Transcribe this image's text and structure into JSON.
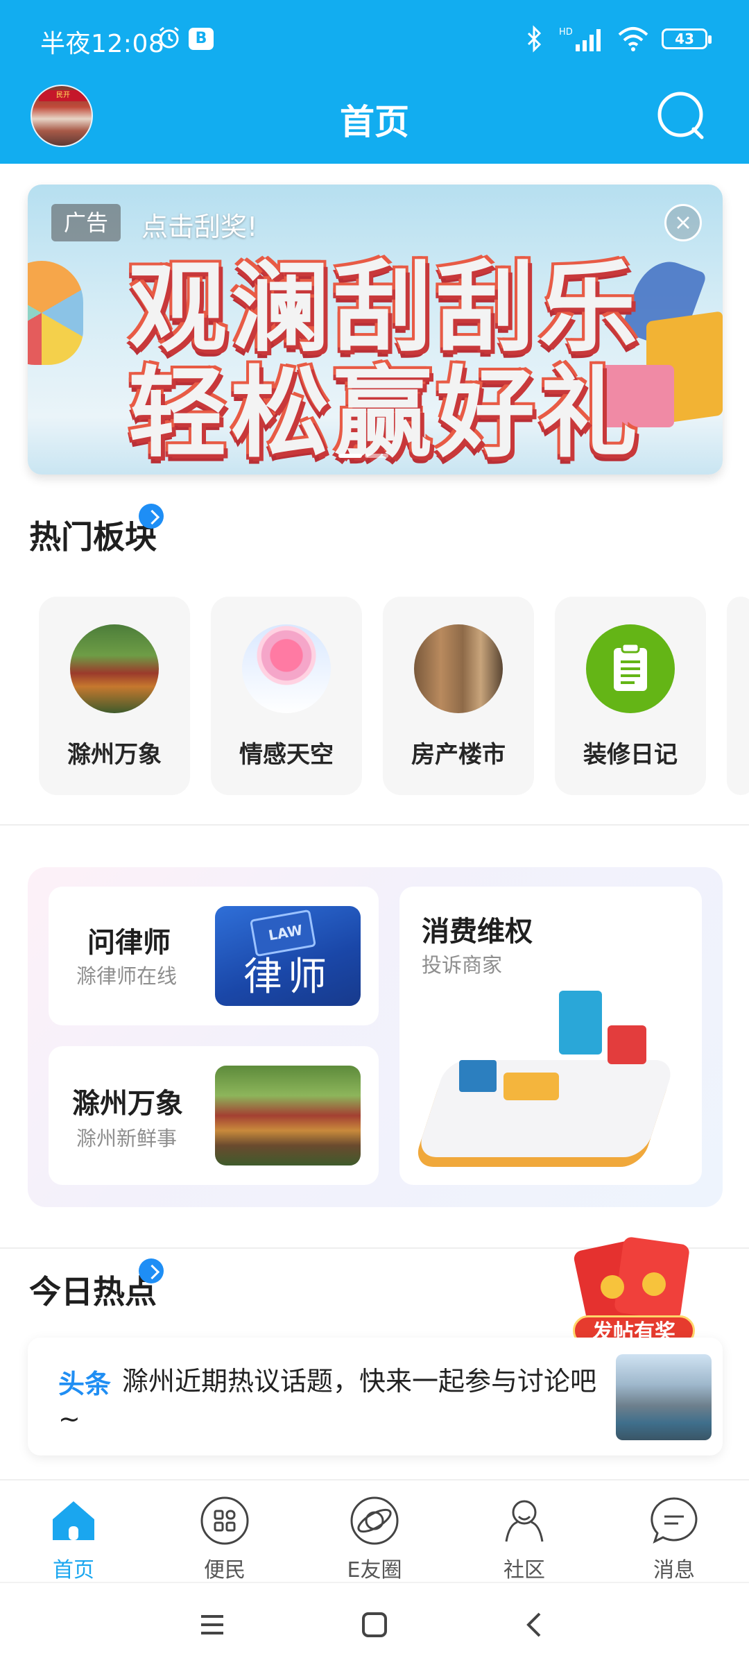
{
  "status_bar": {
    "time": "半夜12:08",
    "app_badge": "B",
    "network": "HD",
    "battery": "43"
  },
  "header": {
    "title": "首页",
    "avatar_sign": "民开"
  },
  "banner": {
    "ad_tag": "广告",
    "cta": "点击刮奖!",
    "headline_line1": "观澜刮刮乐",
    "headline_line2": "轻松赢好礼"
  },
  "hot_boards": {
    "title": "热门板块",
    "items": [
      {
        "label": "滁州万象",
        "icon": "pavilion-image"
      },
      {
        "label": "情感天空",
        "icon": "balloons-image"
      },
      {
        "label": "房产楼市",
        "icon": "building-image"
      },
      {
        "label": "装修日记",
        "icon": "clipboard-icon"
      }
    ]
  },
  "services": {
    "lawyer": {
      "title": "问律师",
      "subtitle": "滁律师在线",
      "image_text": "律师",
      "image_badge": "LAW"
    },
    "wanxiang": {
      "title": "滁州万象",
      "subtitle": "滁州新鲜事"
    },
    "consumer": {
      "title": "消费维权",
      "subtitle": "投诉商家"
    }
  },
  "today_hot": {
    "title": "今日热点",
    "tag": "头条",
    "text": "滁州近期热议话题，快来一起参与讨论吧~"
  },
  "promo": {
    "label": "发帖有奖"
  },
  "tabbar": {
    "items": [
      {
        "label": "首页",
        "icon": "home-icon",
        "active": true
      },
      {
        "label": "便民",
        "icon": "grid-icon",
        "active": false
      },
      {
        "label": "E友圈",
        "icon": "planet-icon",
        "active": false
      },
      {
        "label": "社区",
        "icon": "community-icon",
        "active": false
      },
      {
        "label": "消息",
        "icon": "message-icon",
        "active": false
      }
    ]
  },
  "colors": {
    "brand": "#12adf0",
    "active_tab": "#1aa6ef",
    "link": "#1f8ef3"
  }
}
